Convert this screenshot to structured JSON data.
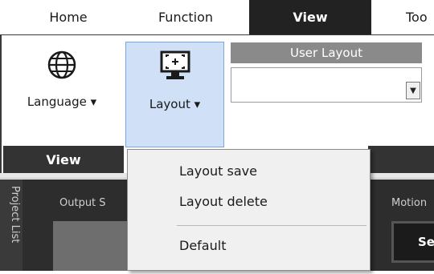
{
  "tabs": [
    {
      "label": "Home"
    },
    {
      "label": "Function"
    },
    {
      "label": "View",
      "active": true
    },
    {
      "label": "Too"
    }
  ],
  "ribbon": {
    "language_button": {
      "label": "Language",
      "icon": "globe-icon"
    },
    "layout_button": {
      "label": "Layout",
      "icon": "monitor-layout-icon"
    },
    "group_label": "View",
    "user_layout": {
      "header": "User Layout",
      "selected_value": ""
    }
  },
  "menu": {
    "items": [
      {
        "label": "Layout save"
      },
      {
        "label": "Layout delete"
      },
      {
        "label": "Default"
      }
    ]
  },
  "workspace": {
    "side_tab": "Project List",
    "output_label": "Output S",
    "motion_label": "Motion",
    "motion_button": "Se"
  },
  "colors": {
    "active_tab_bg": "#222222",
    "layout_button_bg": "#cfe0f7",
    "group_label_bg": "#333333",
    "workspace_bg": "#2d2d2d"
  }
}
